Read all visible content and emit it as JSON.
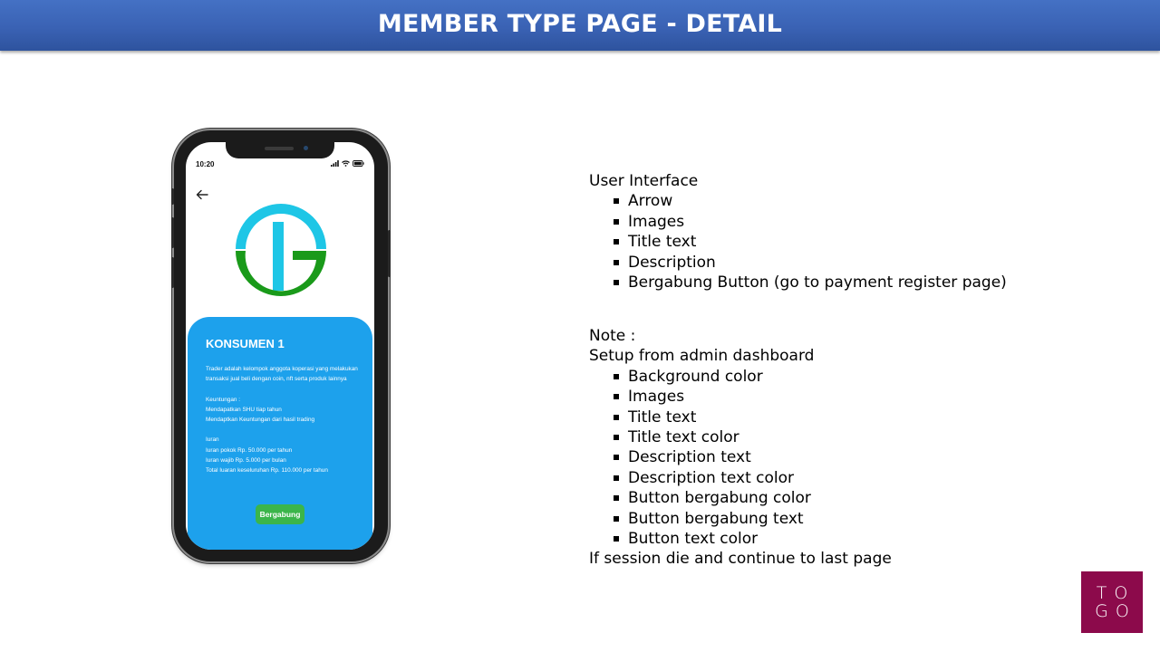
{
  "slide": {
    "title": "MEMBER TYPE PAGE - DETAIL"
  },
  "phone": {
    "status_time": "10:20",
    "card": {
      "title": "KONSUMEN 1",
      "description": "Trader adalah kelompok anggota koperasi yang melakukan transaksi jual beli dengan coin, nft serta produk lainnya",
      "benefits_label": "Keuntungan :",
      "benefits": [
        "Mendapatkan SHU tiap tahun",
        "Mendaptkan Keuntungan dari hasil trading"
      ],
      "fees_label": "Iuran",
      "fees": [
        "Iuran pokok Rp. 50.000 per tahun",
        "Iuran wajib Rp. 5.000 per bulan",
        "Total Iuaran keseluruhan Rp. 110.000 per tahun"
      ],
      "button_label": "Bergabung"
    },
    "colors": {
      "card_background": "#1da1ec",
      "button_background": "#3bb54a",
      "logo_top": "#1ec6e6",
      "logo_bottom": "#1a9a1a"
    },
    "icons": [
      "back-arrow-icon",
      "signal-icon",
      "wifi-icon",
      "battery-icon",
      "togo-logo"
    ]
  },
  "notes": {
    "ui_heading": "User Interface",
    "ui_items": [
      "Arrow",
      "Images",
      "Title text",
      "Description",
      "Bergabung Button (go to payment register page)"
    ],
    "note_heading": "Note :",
    "setup_heading": "Setup from admin dashboard",
    "setup_items": [
      "Background color",
      "Images",
      "Title text",
      "Title text color",
      "Description text",
      "Description text color",
      "Button bergabung color",
      "Button bergabung text",
      "Button text color"
    ],
    "footer": "If session die and continue to last page"
  },
  "badge": {
    "line1": "TO",
    "line2": "GO",
    "color": "#8c0a4b"
  }
}
